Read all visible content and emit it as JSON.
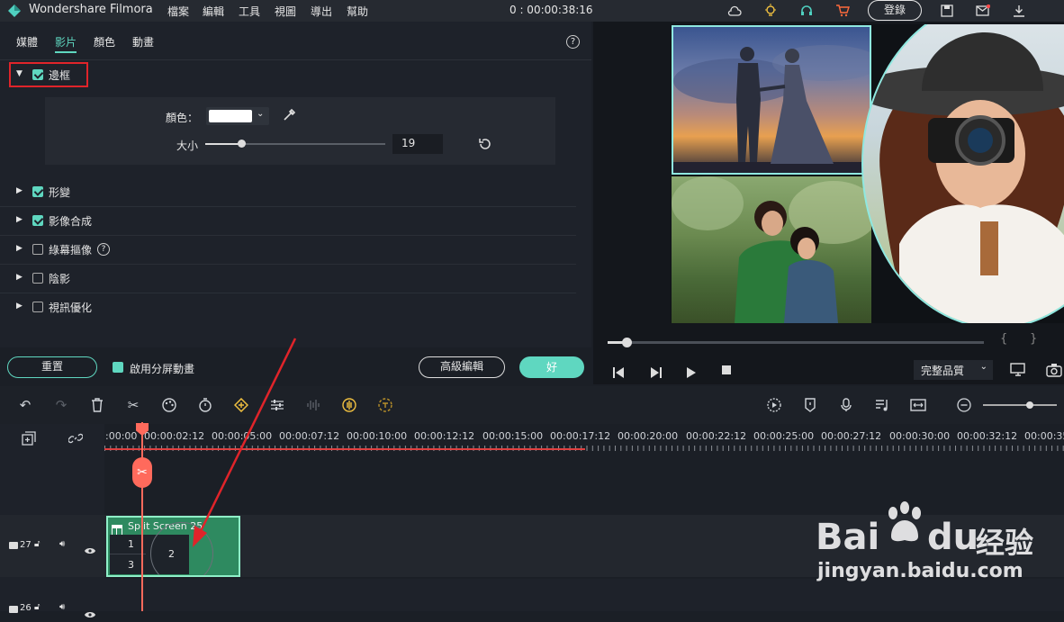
{
  "app": {
    "title": "Wondershare Filmora",
    "timecode": "0 : 00:00:38:16"
  },
  "menu": [
    "檔案",
    "編輯",
    "工具",
    "視圖",
    "導出",
    "幫助"
  ],
  "topbar": {
    "login_label": "登錄"
  },
  "panel_tabs": [
    "媒體",
    "影片",
    "顏色",
    "動畫"
  ],
  "border_section": {
    "label": "邊框",
    "color_label": "顏色：",
    "size_label": "大小",
    "size_value": "19",
    "color_value": "#ffffff",
    "size_fraction": 0.2
  },
  "sections": [
    {
      "label": "形變",
      "checked": true
    },
    {
      "label": "影像合成",
      "checked": true
    },
    {
      "label": "綠幕摳像",
      "checked": false
    },
    {
      "label": "陰影",
      "checked": false
    },
    {
      "label": "視訊優化",
      "checked": false
    }
  ],
  "panel_footer": {
    "reset_label": "重置",
    "split_anim_label": "啟用分屏動畫",
    "advanced_label": "高級編輯",
    "ok_label": "好"
  },
  "player": {
    "quality_label": "完整品質",
    "brace_left": "{",
    "brace_right": "}",
    "progress_fraction": 0.05
  },
  "ruler_ticks": [
    ":00:00",
    "00:00:02:12",
    "00:00:05:00",
    "00:00:07:12",
    "00:00:10:00",
    "00:00:12:12",
    "00:00:15:00",
    "00:00:17:12",
    "00:00:20:00",
    "00:00:22:12",
    "00:00:25:00",
    "00:00:27:12",
    "00:00:30:00",
    "00:00:32:12",
    "00:00:35"
  ],
  "tracks": [
    {
      "number": "27"
    },
    {
      "number": "26"
    }
  ],
  "clip": {
    "title": "Split Screen 25",
    "cells": [
      "1",
      "2",
      "3"
    ]
  },
  "watermark": {
    "brand": "Bai",
    "brand2": "du",
    "cn": "经验",
    "url": "jingyan.baidu.com"
  },
  "colors": {
    "accent": "#5fd7c0",
    "playhead": "#ff6a5c",
    "annotation": "#e0242a"
  }
}
